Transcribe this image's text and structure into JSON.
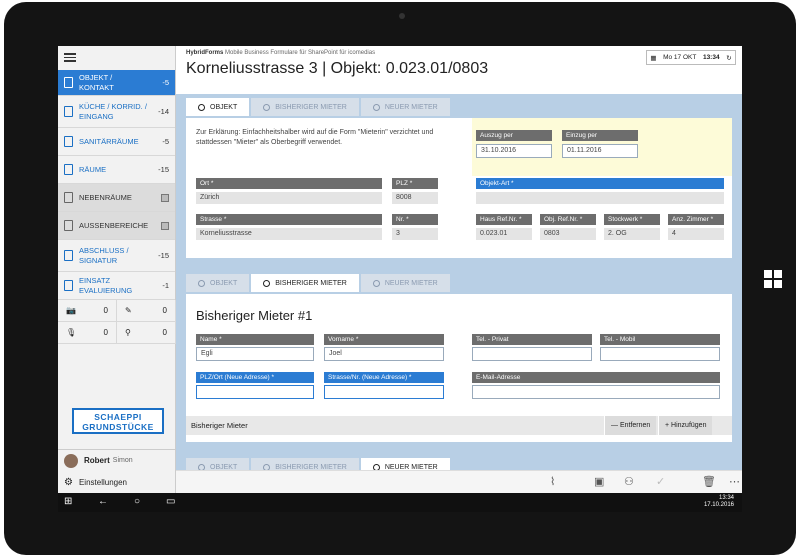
{
  "app": {
    "brand": "HybridForms",
    "brand_sub": "Mobile Business Formulare für SharePoint für icomedias",
    "title": "Korneliusstrasse 3 | Objekt: 0.023.01/0803",
    "date": "Mo 17 OKT",
    "time": "13:34"
  },
  "sidebar": {
    "items": [
      {
        "label": "OBJEKT / KONTAKT",
        "count": "-5"
      },
      {
        "label": "KÜCHE / KORRID. / EINGANG",
        "count": "-14"
      },
      {
        "label": "SANITÄRRÄUME",
        "count": "-5"
      },
      {
        "label": "RÄUME",
        "count": "-15"
      },
      {
        "label": "NEBENRÄUME",
        "count": ""
      },
      {
        "label": "AUSSENBEREICHE",
        "count": ""
      },
      {
        "label": "ABSCHLUSS / SIGNATUR",
        "count": "-15"
      },
      {
        "label": "EINSATZ EVALUIERUNG",
        "count": "-1"
      }
    ],
    "counters": [
      "0",
      "0",
      "0",
      "0"
    ],
    "logo_line1": "SCHAEPPI",
    "logo_line2": "GRUNDSTÜCKE",
    "user_name": "Robert",
    "user_sub": "Simon",
    "settings": "Einstellungen"
  },
  "tabs1": [
    "OBJEKT",
    "BISHERIGER MIETER",
    "NEUER MIETER"
  ],
  "tabs2": [
    "OBJEKT",
    "BISHERIGER MIETER",
    "NEUER MIETER"
  ],
  "tabs3": [
    "OBJEKT",
    "BISHERIGER MIETER",
    "NEUER MIETER"
  ],
  "objekt": {
    "note": "Zur Erklärung: Einfachheitshalber wird auf die Form \"Mieterin\" verzichtet und stattdessen \"Mieter\" als Oberbegriff verwendet.",
    "auszug_label": "Auszug per",
    "auszug": "31.10.2016",
    "einzug_label": "Einzug per",
    "einzug": "01.11.2016",
    "ort_label": "Ort *",
    "ort": "Zürich",
    "plz_label": "PLZ *",
    "plz": "8008",
    "objektart_label": "Objekt-Art *",
    "strasse_label": "Strasse *",
    "strasse": "Korneliusstrasse",
    "nr_label": "Nr. *",
    "nr": "3",
    "haus_label": "Haus Ref.Nr. *",
    "haus": "0.023.01",
    "obj_label": "Obj. Ref.Nr. *",
    "obj": "0803",
    "stock_label": "Stockwerk *",
    "stock": "2. OG",
    "zimmer_label": "Anz. Zimmer *",
    "zimmer": "4"
  },
  "mieter": {
    "heading": "Bisheriger Mieter #1",
    "name_label": "Name *",
    "name": "Egli",
    "vorname_label": "Vorname *",
    "vorname": "Joel",
    "telp_label": "Tel. - Privat",
    "telm_label": "Tel. - Mobil",
    "plzort_label": "PLZ/Ort (Neue Adresse) *",
    "strasse_label": "Strasse/Nr. (Neue Adresse) *",
    "email_label": "E-Mail-Adresse",
    "footer": "Bisheriger Mieter",
    "remove": "Entfernen",
    "add": "Hinzufügen"
  },
  "taskbar": {
    "time": "13:34",
    "date": "17.10.2016"
  }
}
